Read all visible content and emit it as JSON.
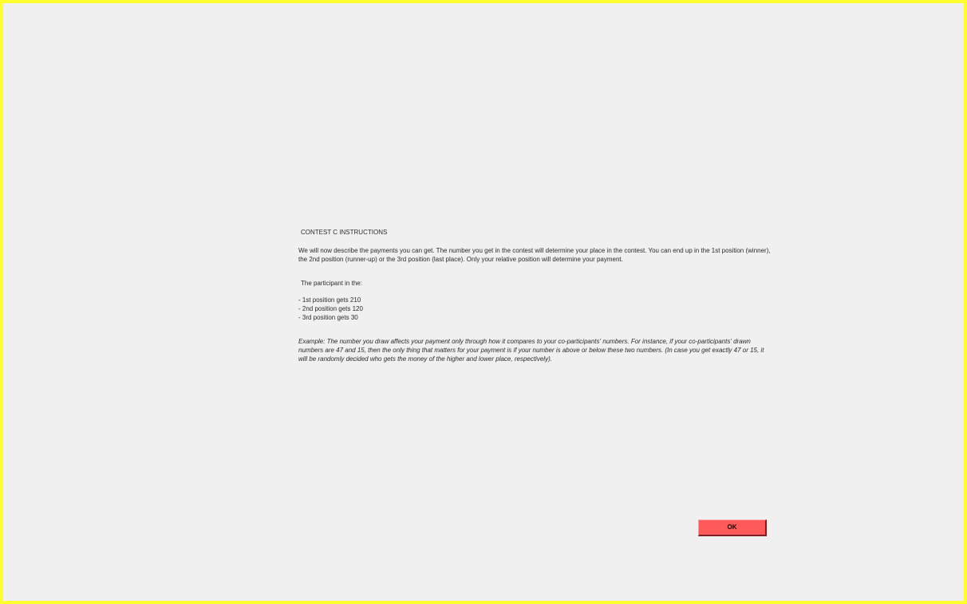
{
  "instructions": {
    "title": "CONTEST C  INSTRUCTIONS",
    "intro": "We will now describe the payments you can get. The number you get in the contest will determine your place in the contest. You can end up in the 1st position (winner), the 2nd position (runner-up) or the 3rd position (last place). Only your relative position will determine your payment.",
    "participant_label": "The participant in the:",
    "payments": [
      "- 1st position gets 210",
      "- 2nd position gets 120",
      "- 3rd position gets 30"
    ],
    "example": "Example: The number you draw affects your payment only through how it compares to your co-participants' numbers. For instance, if your co-participants' drawn numbers are 47 and 15, then the only thing that matters for your payment is if your number is above or below these two numbers. (In case you get exactly 47 or 15, it will be randomly decided who gets the money of the higher and lower place, respectively)."
  },
  "buttons": {
    "ok_label": "OK"
  },
  "colors": {
    "frame_border": "#ffff2e",
    "background": "#f0f0f0",
    "ok_button": "#ff5a5a"
  }
}
